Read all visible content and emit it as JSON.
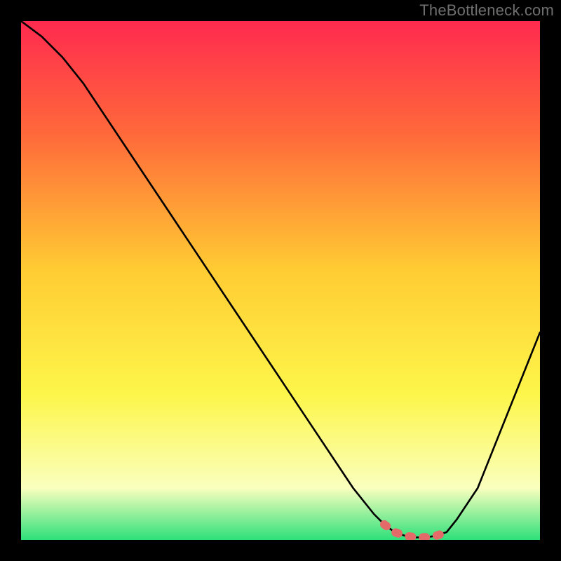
{
  "watermark": "TheBottleneck.com",
  "colors": {
    "bg": "#000000",
    "gradient_top": "#ff2a4f",
    "gradient_mid_upper": "#ff6a3a",
    "gradient_mid": "#ffcc33",
    "gradient_mid_lower": "#fdf64a",
    "gradient_pale": "#faffbe",
    "gradient_bottom": "#2de07a",
    "curve": "#000000",
    "marker": "#e46a6a"
  },
  "chart_data": {
    "type": "line",
    "title": "",
    "xlabel": "",
    "ylabel": "",
    "xlim": [
      0,
      100
    ],
    "ylim": [
      0,
      100
    ],
    "series": [
      {
        "name": "bottleneck-curve",
        "x": [
          0,
          4,
          8,
          12,
          16,
          20,
          24,
          28,
          32,
          36,
          40,
          44,
          48,
          52,
          56,
          60,
          64,
          68,
          70,
          72,
          74,
          76,
          78,
          80,
          82,
          84,
          88,
          92,
          96,
          100
        ],
        "y": [
          100,
          97,
          93,
          88,
          82,
          76,
          70,
          64,
          58,
          52,
          46,
          40,
          34,
          28,
          22,
          16,
          10,
          5,
          3,
          1.5,
          0.8,
          0.5,
          0.5,
          0.8,
          1.5,
          4,
          10,
          20,
          30,
          40
        ]
      }
    ],
    "highlight": {
      "name": "sweet-spot",
      "x": [
        70,
        72,
        74,
        76,
        78,
        80,
        82
      ],
      "y": [
        3,
        1.5,
        0.8,
        0.5,
        0.5,
        0.8,
        1.5
      ]
    }
  }
}
